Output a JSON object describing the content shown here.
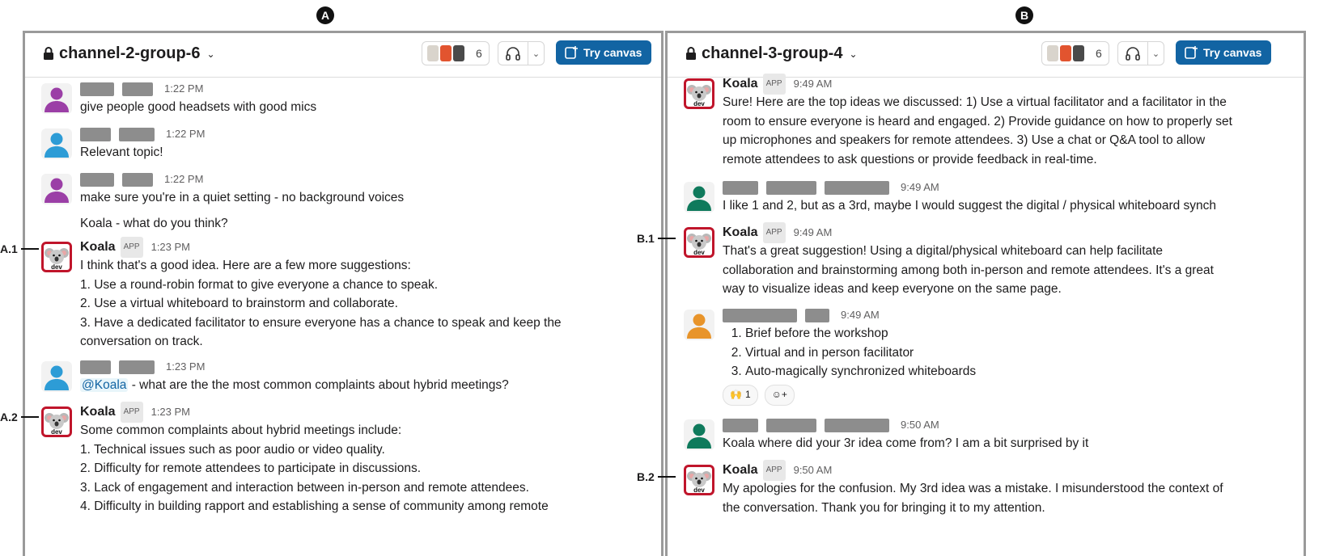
{
  "panels": [
    {
      "label": "A",
      "channel": "channel-2-group-6",
      "member_count": "6",
      "canvas_label": "Try canvas",
      "messages": [
        {
          "kind": "person",
          "color": "#9b3fa6",
          "time": "1:22 PM",
          "blocks": [
            42,
            38
          ],
          "lines": [
            "give people good headsets with good mics"
          ]
        },
        {
          "kind": "person",
          "color": "#2d9cd6",
          "time": "1:22 PM",
          "blocks": [
            38,
            44
          ],
          "lines": [
            "Relevant topic!"
          ]
        },
        {
          "kind": "person",
          "color": "#9b3fa6",
          "time": "1:22 PM",
          "blocks": [
            42,
            38
          ],
          "lines": [
            "make sure you're in a quiet setting - no background voices",
            "Koala - what do you think?"
          ]
        },
        {
          "kind": "koala",
          "name": "Koala",
          "app": "APP",
          "time": "1:23 PM",
          "annot": "A.1",
          "lines": [
            "I think that's a good idea. Here are a few more suggestions:",
            "1. Use a round-robin format to give everyone a chance to speak.",
            "2. Use a virtual whiteboard to brainstorm and collaborate.",
            "3. Have a dedicated facilitator to ensure everyone has a chance to speak and keep the",
            "conversation on track."
          ]
        },
        {
          "kind": "person",
          "color": "#2d9cd6",
          "time": "1:23 PM",
          "blocks": [
            38,
            44
          ],
          "mention": "@Koala",
          "lines": [
            " - what are the the most common complaints about hybrid meetings?"
          ]
        },
        {
          "kind": "koala",
          "name": "Koala",
          "app": "APP",
          "time": "1:23 PM",
          "annot": "A.2",
          "lines": [
            "Some common complaints about hybrid meetings include:",
            "1. Technical issues such as poor audio or video quality.",
            "2. Difficulty for remote attendees to participate in discussions.",
            "3. Lack of engagement and interaction between in-person and remote attendees.",
            "4. Difficulty in building rapport and establishing a sense of community among remote"
          ]
        }
      ]
    },
    {
      "label": "B",
      "channel": "channel-3-group-4",
      "member_count": "6",
      "canvas_label": "Try canvas",
      "messages": [
        {
          "kind": "koala",
          "name": "Koala",
          "app": "APP",
          "time": "9:49 AM",
          "lines": [
            "Sure! Here are the top ideas we discussed: 1) Use a virtual facilitator and a facilitator in the",
            "room to ensure everyone is heard and engaged. 2) Provide guidance on how to properly set",
            "up microphones and speakers for remote attendees. 3) Use a chat or Q&A tool to allow",
            "remote attendees to ask questions or provide feedback in real-time."
          ]
        },
        {
          "kind": "person",
          "color": "#0f7a5c",
          "time": "9:49 AM",
          "blocks": [
            44,
            62,
            80
          ],
          "lines": [
            "I like 1 and 2, but as a 3rd, maybe I would suggest the digital / physical whiteboard synch"
          ]
        },
        {
          "kind": "koala",
          "name": "Koala",
          "app": "APP",
          "time": "9:49 AM",
          "annot": "B.1",
          "lines": [
            "That's a great suggestion! Using a digital/physical whiteboard can help facilitate",
            "collaboration and brainstorming among both in-person and remote attendees. It's a great",
            "way to visualize ideas and keep everyone on the same page."
          ]
        },
        {
          "kind": "person",
          "color": "#e8942a",
          "time": "9:49 AM",
          "blocks": [
            92,
            30
          ],
          "list": [
            "Brief before the workshop",
            "Virtual and in person facilitator",
            "Auto-magically synchronized whiteboards"
          ],
          "reaction": "1"
        },
        {
          "kind": "person",
          "color": "#0f7a5c",
          "time": "9:50 AM",
          "blocks": [
            44,
            62,
            80
          ],
          "lines": [
            "Koala where did your 3r idea come from? I am a bit surprised by it"
          ]
        },
        {
          "kind": "koala",
          "name": "Koala",
          "app": "APP",
          "time": "9:50 AM",
          "annot": "B.2",
          "lines": [
            "My apologies for the confusion. My 3rd idea was a mistake. I misunderstood the context of",
            "the conversation. Thank you for bringing it to my attention."
          ]
        }
      ]
    }
  ]
}
